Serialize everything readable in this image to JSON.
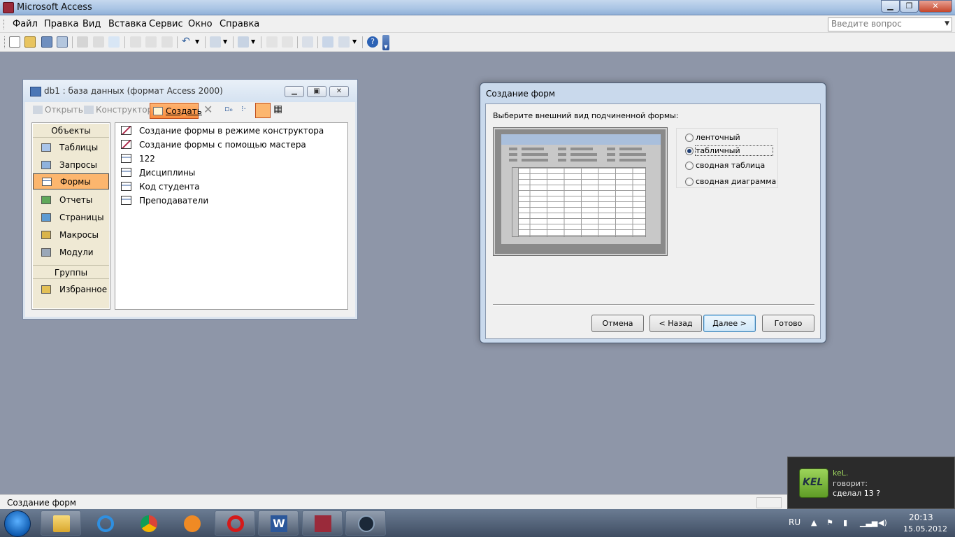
{
  "app": {
    "title": "Microsoft Access"
  },
  "menu": {
    "items": [
      "Файл",
      "Правка",
      "Вид",
      "Вставка",
      "Сервис",
      "Окно",
      "Справка"
    ],
    "help_placeholder": "Введите вопрос"
  },
  "db_window": {
    "title": "db1 : база данных (формат Access 2000)",
    "toolbar": {
      "open": "Открыть",
      "design": "Конструктор",
      "create": "Создать"
    },
    "objects_header": "Объекты",
    "objects": [
      "Таблицы",
      "Запросы",
      "Формы",
      "Отчеты",
      "Страницы",
      "Макросы",
      "Модули"
    ],
    "selected_object": "Формы",
    "groups_header": "Группы",
    "groups": [
      "Избранное"
    ],
    "list": [
      "Создание формы в режиме конструктора",
      "Создание формы с помощью мастера",
      "122",
      "Дисциплины",
      "Код студента",
      "Преподаватели"
    ]
  },
  "wizard": {
    "title": "Создание форм",
    "prompt": "Выберите внешний вид подчиненной формы:",
    "options": [
      "ленточный",
      "табличный",
      "сводная таблица",
      "сводная диаграмма"
    ],
    "selected_option": "табличный",
    "buttons": {
      "cancel": "Отмена",
      "back": "< Назад",
      "next": "Далее >",
      "finish": "Готово"
    }
  },
  "statusbar": {
    "text": "Создание форм"
  },
  "notification": {
    "sender": "keL.",
    "says": "говорит:",
    "message": "сделал 13 ?",
    "avatar_text": "KEL"
  },
  "taskbar": {
    "language": "RU",
    "time": "20:13",
    "date": "15.05.2012"
  }
}
